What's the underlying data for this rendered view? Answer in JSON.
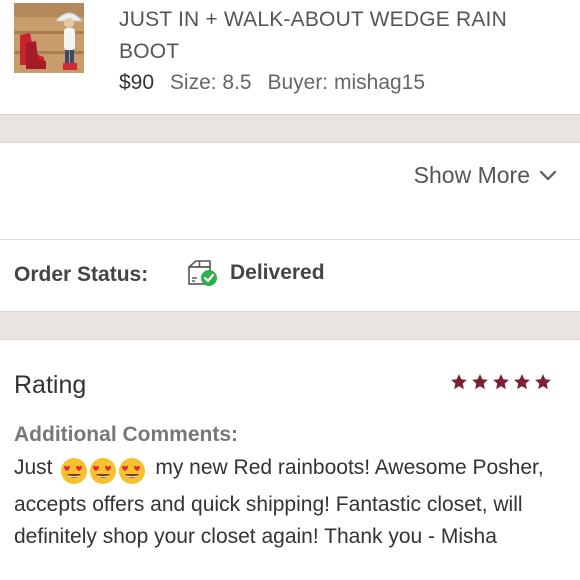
{
  "product": {
    "title": "JUST IN + WALK-ABOUT WEDGE RAIN BOOT",
    "price": "$90",
    "size": "Size: 8.5",
    "buyer": "Buyer: mishag15"
  },
  "details": {
    "show_more_label": "Show More",
    "chevron_icon": "chevron-down-icon"
  },
  "order_status": {
    "label": "Order Status:",
    "value": "Delivered",
    "icon": "package-delivered-icon",
    "status_color": "#2eae4f"
  },
  "rating": {
    "title": "Rating",
    "stars": 5,
    "max_stars": 5,
    "star_color": "#7d1f35",
    "comments_label": "Additional Comments:",
    "comment_before": "Just",
    "comment_emojis": [
      "heart-eyes-emoji",
      "heart-eyes-emoji",
      "heart-eyes-emoji"
    ],
    "comment_after": "my new Red rainboots! Awesome Posher, accepts offers and quick shipping! Fantastic closet, will definitely shop your closet again! Thank you - Misha"
  }
}
